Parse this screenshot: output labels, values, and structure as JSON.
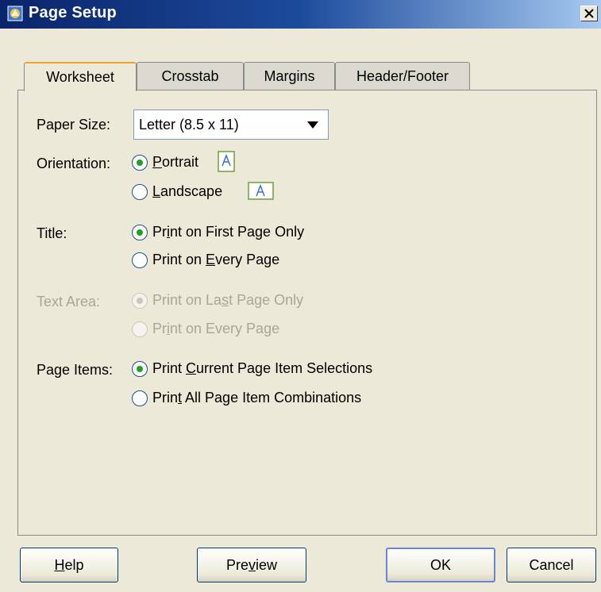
{
  "window": {
    "title": "Page Setup",
    "close_label": "×"
  },
  "tabs": [
    "Worksheet",
    "Crosstab",
    "Margins",
    "Header/Footer"
  ],
  "active_tab": "Worksheet",
  "paper_size": {
    "label": "Paper Size:",
    "value": "Letter (8.5 x 11)"
  },
  "orientation": {
    "label": "Orientation:",
    "portrait_pre": "",
    "portrait_u": "P",
    "portrait_post": "ortrait",
    "landscape_pre": "",
    "landscape_u": "L",
    "landscape_post": "andscape",
    "selected": "Portrait"
  },
  "title_opt": {
    "label": "Title:",
    "first_pre": "Pr",
    "first_u": "i",
    "first_post": "nt on First Page Only",
    "every_pre": "Print on ",
    "every_u": "E",
    "every_post": "very Page",
    "selected": "Print on First Page Only"
  },
  "text_area": {
    "label": "Text Area:",
    "last_pre": "Print on La",
    "last_u": "s",
    "last_post": "t Page Only",
    "every_pre": "Pr",
    "every_u": "i",
    "every_post": "nt on Every Page",
    "selected": "Print on Last Page Only",
    "enabled": false
  },
  "page_items": {
    "label": "Page Items:",
    "current_pre": "Print ",
    "current_u": "C",
    "current_post": "urrent Page Item Selections",
    "all_pre": "Prin",
    "all_u": "t",
    "all_post": " All Page Item Combinations",
    "selected": "Print Current Page Item Selections"
  },
  "buttons": {
    "help_u": "H",
    "help_post": "elp",
    "preview_pre": "Pre",
    "preview_u": "v",
    "preview_post": "iew",
    "ok": "OK",
    "cancel": "Cancel"
  },
  "colors": {
    "title_bar": "#0a246a",
    "tab_accent": "#f0a030",
    "radio_dot": "#21a121"
  }
}
